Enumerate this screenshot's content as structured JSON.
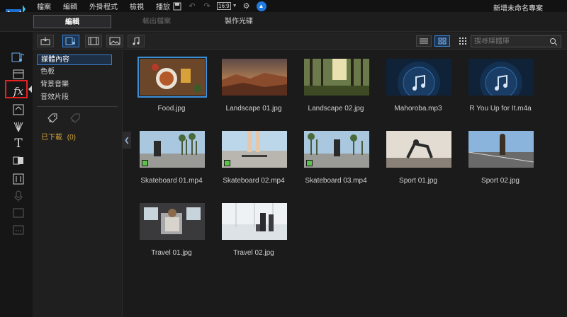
{
  "menubar": {
    "items": [
      "檔案",
      "編輯",
      "外掛程式",
      "檢視",
      "播放"
    ],
    "ratio": "16:9",
    "project_name": "新增未命名專案"
  },
  "modes": {
    "edit": "編輯",
    "output": "輸出檔案",
    "disc": "製作光碟"
  },
  "search": {
    "placeholder": "搜尋媒體庫"
  },
  "tree": {
    "items": [
      "媒體內容",
      "色板",
      "背景音樂",
      "音效片段"
    ],
    "download_label": "已下載",
    "download_count": "(0)"
  },
  "media": [
    {
      "name": "Food.jpg",
      "kind": "image",
      "selected": true
    },
    {
      "name": "Landscape 01.jpg",
      "kind": "image"
    },
    {
      "name": "Landscape 02.jpg",
      "kind": "image"
    },
    {
      "name": "Mahoroba.mp3",
      "kind": "audio"
    },
    {
      "name": "R You Up for It.m4a",
      "kind": "audio"
    },
    {
      "name": "Skateboard 01.mp4",
      "kind": "video"
    },
    {
      "name": "Skateboard 02.mp4",
      "kind": "video"
    },
    {
      "name": "Skateboard 03.mp4",
      "kind": "video"
    },
    {
      "name": "Sport 01.jpg",
      "kind": "image"
    },
    {
      "name": "Sport 02.jpg",
      "kind": "image"
    },
    {
      "name": "Travel 01.jpg",
      "kind": "image"
    },
    {
      "name": "Travel 02.jpg",
      "kind": "image"
    }
  ],
  "colors": {
    "accent": "#3a84d6",
    "highlight": "#e52121",
    "download": "#d2a43a"
  }
}
